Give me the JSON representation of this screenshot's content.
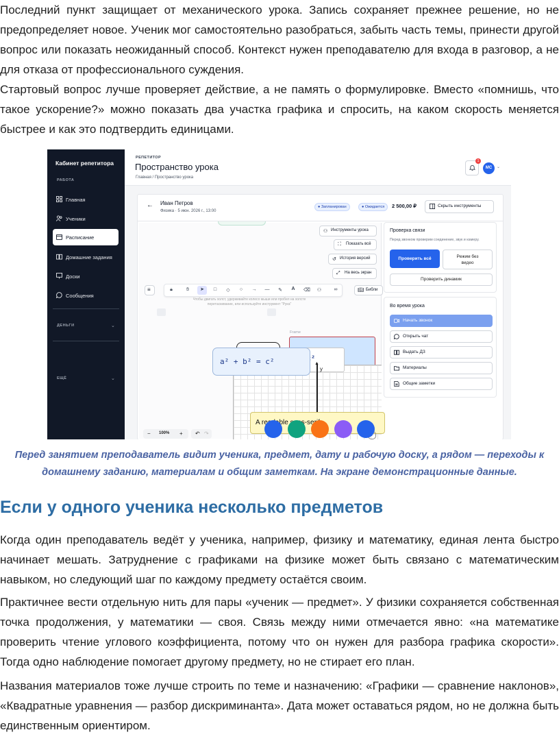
{
  "para1": "Последний пункт защищает от механического урока. Запись сохраняет прежнее решение, но не предопределяет новое. Ученик мог самостоятельно разобраться, забыть часть темы, принести другой вопрос или показать неожиданный способ. Контекст нужен преподавателю для входа в разговор, а не для отказа от профессионального суждения.",
  "para2": "Стартовый вопрос лучше проверяет действие, а не память о формулировке. Вместо «помнишь, что такое ускорение?» можно показать два участка графика и спросить, на каком скорость меняется быстрее и как это подтвердить единицами.",
  "screenshot": {
    "sidebar": {
      "title": "Кабинет репетитора",
      "section_work": "РАБОТА",
      "items": [
        {
          "label": "Главная",
          "icon": "grid-icon"
        },
        {
          "label": "Ученики",
          "icon": "users-icon"
        },
        {
          "label": "Расписание",
          "icon": "calendar-icon"
        },
        {
          "label": "Домашние задания",
          "icon": "book-icon"
        },
        {
          "label": "Доски",
          "icon": "monitor-icon"
        },
        {
          "label": "Сообщения",
          "icon": "chat-icon"
        }
      ],
      "section_money": "ДЕНЬГИ",
      "section_other": "ЕЩЁ"
    },
    "topbar": {
      "role": "РЕПЕТИТОР",
      "title": "Пространство урока",
      "breadcrumb": "Главная / Пространство урока",
      "bell_count": "1",
      "avatar": "МС"
    },
    "lesson": {
      "student": "Иван Петров",
      "meta": "Физика · 5 июн. 2026 г., 13:00",
      "status1": "● Запланирован",
      "status2": "● Ожидается",
      "price": "2 500,00 ₽",
      "hide_tools": "Скрыть инструменты"
    },
    "board": {
      "tools_btn": "Инструменты урока",
      "show_all": "Показать всё",
      "history": "История версий",
      "fullscreen": "На весь экран",
      "library": "Библи",
      "hint": "Чтобы двигать холст, удерживайте колесо мыши или пробел на холсте перетаскивание, или используйте инструмент \"Рука\"",
      "frame_label": "Frame",
      "formula": "a² + b² = c²",
      "formula_partial": "c²",
      "axis_y": "y",
      "sticky": "A readable sans-serif",
      "zoom": "100%"
    },
    "right_panel": {
      "check_title": "Проверка связи",
      "check_note": "Перед звонком проверим соединение, звук и камеру.",
      "check_all": "Проверить всё",
      "no_video": "Режим без видео",
      "check_speakers": "Проверить динамик",
      "during": "Во время урока",
      "actions": [
        {
          "label": "Начать звонок",
          "icon": "video-icon"
        },
        {
          "label": "Открыть чат",
          "icon": "chat-icon"
        },
        {
          "label": "Выдать ДЗ",
          "icon": "book-icon"
        },
        {
          "label": "Материалы",
          "icon": "folder-icon"
        },
        {
          "label": "Общие заметки",
          "icon": "note-icon"
        }
      ]
    },
    "colors": {
      "sidebar": "#111827",
      "primary": "#2563eb",
      "dot1": "#2563eb",
      "dot2": "#10a37f",
      "dot3": "#f97316",
      "dot4": "#8b5cf6",
      "dot5": "#2563eb"
    }
  },
  "caption": "Перед занятием преподаватель видит ученика, предмет, дату и рабочую доску, а рядом — переходы к домашнему заданию, материалам и общим заметкам. На экране демонстрационные данные.",
  "heading": "Если у одного ученика несколько предметов",
  "para3": "Когда один преподаватель ведёт у ученика, например, физику и математику, единая лента быстро начинает мешать. Затруднение с графиками на физике может быть связано с математическим навыком, но следующий шаг по каждому предмету остаётся своим.",
  "para4": "Практичнее вести отдельную нить для пары «ученик — предмет». У физики сохраняется собственная точка продолжения, у математики — своя. Связь между ними отмечается явно: «на математике проверить чтение углового коэффициента, потому что он нужен для разбора графика скорости». Тогда одно наблюдение помогает другому предмету, но не стирает его план.",
  "para5": "Названия материалов тоже лучше строить по теме и назначению: «Графики — сравнение наклонов», «Квадратные уравнения — разбор дискриминанта». Дата может оставаться рядом, но не должна быть единственным ориентиром."
}
